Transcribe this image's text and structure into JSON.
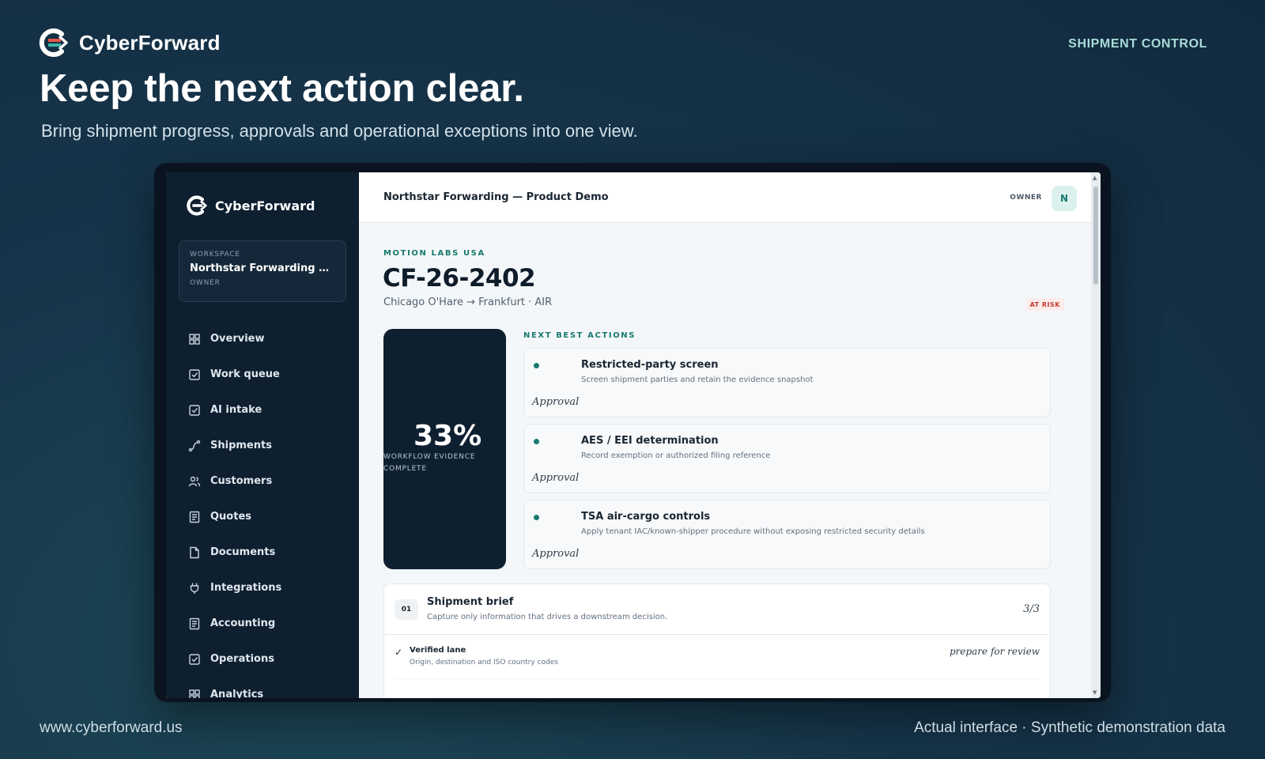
{
  "header": {
    "brand": "CyberForward",
    "tag": "SHIPMENT CONTROL",
    "title": "Keep the next action clear.",
    "subtitle": "Bring shipment progress, approvals and operational exceptions into one view."
  },
  "footer": {
    "url": "www.cyberforward.us",
    "note": "Actual interface · Synthetic demonstration data"
  },
  "app": {
    "brand": "CyberForward",
    "workspace": {
      "kicker": "WORKSPACE",
      "name": "Northstar Forwarding — P...",
      "role": "OWNER"
    },
    "nav": [
      {
        "label": "Overview",
        "icon": "grid-icon"
      },
      {
        "label": "Work queue",
        "icon": "checkbox-icon"
      },
      {
        "label": "AI intake",
        "icon": "checkbox-icon"
      },
      {
        "label": "Shipments",
        "icon": "route-icon"
      },
      {
        "label": "Customers",
        "icon": "users-icon"
      },
      {
        "label": "Quotes",
        "icon": "list-doc-icon"
      },
      {
        "label": "Documents",
        "icon": "file-icon"
      },
      {
        "label": "Integrations",
        "icon": "plug-icon"
      },
      {
        "label": "Accounting",
        "icon": "list-doc-icon"
      },
      {
        "label": "Operations",
        "icon": "checkbox-icon"
      },
      {
        "label": "Analytics",
        "icon": "grid-icon"
      }
    ],
    "topbar": {
      "title": "Northstar Forwarding — Product Demo",
      "role": "OWNER",
      "avatar": "N"
    },
    "shipment": {
      "customer": "MOTION LABS USA",
      "id": "CF-26-2402",
      "route": "Chicago O'Hare → Frankfurt · AIR",
      "status": "AT RISK",
      "progress": "33%",
      "progress_value": 0.33,
      "progress_caption": "WORKFLOW EVIDENCE COMPLETE"
    },
    "next_actions": {
      "label": "NEXT BEST ACTIONS",
      "items": [
        {
          "title": "Restricted-party screen",
          "desc": "Screen shipment parties and retain the evidence snapshot",
          "type": "Approval"
        },
        {
          "title": "AES / EEI determination",
          "desc": "Record exemption or authorized filing reference",
          "type": "Approval"
        },
        {
          "title": "TSA air-cargo controls",
          "desc": "Apply tenant IAC/known-shipper procedure without exposing restricted security details",
          "type": "Approval"
        }
      ]
    },
    "brief": {
      "num": "01",
      "title": "Shipment brief",
      "subtitle": "Capture only information that drives a downstream decision.",
      "count": "3/3",
      "rows": [
        {
          "check": "✓",
          "title": "Verified lane",
          "desc": "Origin, destination and ISO country codes",
          "action": "prepare for review"
        }
      ]
    },
    "colors": {
      "accent": "#177a6f",
      "sidebar": "#0e1f30",
      "risk": "#c0392b"
    }
  }
}
